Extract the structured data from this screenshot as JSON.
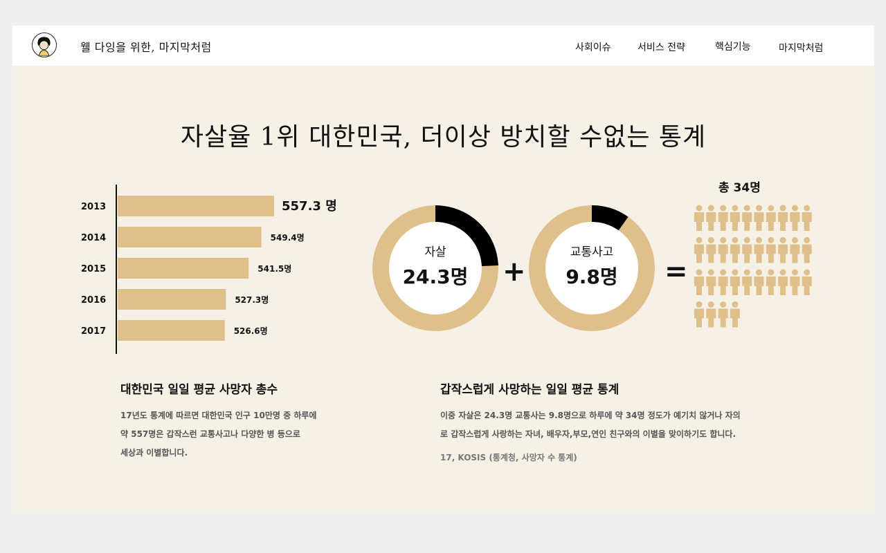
{
  "header": {
    "brand": "웰 다잉을 위한, 마지막처럼",
    "nav": [
      "사회이슈",
      "서비스 전략",
      "핵심기능",
      "마지막처럼"
    ]
  },
  "headline": "자살율 1위 대한민국, 더이상 방치할 수없는 통계",
  "chart_data": [
    {
      "type": "bar",
      "categories": [
        "2013",
        "2014",
        "2015",
        "2016",
        "2017"
      ],
      "values": [
        557.3,
        549.4,
        541.5,
        527.3,
        526.6
      ],
      "value_labels": [
        "557.3 명",
        "549.4명",
        "541.5명",
        "527.3명",
        "526.6명"
      ],
      "orientation": "horizontal",
      "color": "#e0c08a"
    },
    {
      "type": "pie",
      "variant": "donut",
      "label": "자살",
      "value_label": "24.3명",
      "fraction": 0.243,
      "colors": {
        "filled": "#000000",
        "rest": "#e0c08a"
      }
    },
    {
      "type": "pie",
      "variant": "donut",
      "label": "교통사고",
      "value_label": "9.8명",
      "fraction": 0.098,
      "colors": {
        "filled": "#000000",
        "rest": "#e0c08a"
      }
    }
  ],
  "operators": {
    "plus": "+",
    "equals": "="
  },
  "total": {
    "label": "총 34명",
    "count": 34,
    "color": "#e0c08a"
  },
  "sections": {
    "left": {
      "title": "대한민국 일일 평균 사망자 총수",
      "lines": [
        "17년도 통계에 따르면 대한민국 인구 10만명 중 하루에",
        "약 557명은 갑작스런 교통사고나 다양한 병 등으로",
        "세상과 이별합니다."
      ]
    },
    "right": {
      "title": "갑작스럽게 사망하는 일일 평균 통계",
      "lines": [
        "이중 자살은 24.3명 교통사는 9.8명으로 하루에 약 34명 정도가 예기치 않거나 자의",
        "로 갑작스럽게 사랑하는 자녀, 배우자,부모,연인 친구와의 이별을 맞이하기도 합니다."
      ],
      "source": "17, KOSIS (통계청, 사망자 수 통계)"
    }
  },
  "colors": {
    "accent": "#e0c08a",
    "background": "#f6f1e6",
    "dark": "#000000"
  }
}
